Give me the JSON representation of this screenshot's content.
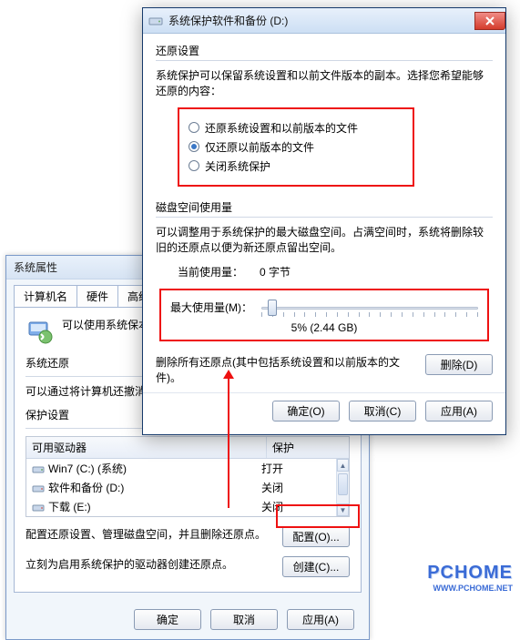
{
  "back": {
    "title": "系统属性",
    "tabs": [
      "计算机名",
      "硬件",
      "高级"
    ],
    "info": "可以使用系统保本的文件。什",
    "groups": {
      "restore_label": "系统还原",
      "restore_desc": "可以通过将计算机还撤消系统更改。",
      "protect_label": "保护设置"
    },
    "drives": {
      "head_drive": "可用驱动器",
      "head_protect": "保护",
      "rows": [
        {
          "name": "Win7 (C:) (系统)",
          "state": "打开"
        },
        {
          "name": "软件和备份 (D:)",
          "state": "关闭"
        },
        {
          "name": "下载 (E:)",
          "state": "关闭"
        }
      ]
    },
    "config_desc": "配置还原设置、管理磁盘空间，并且删除还原点。",
    "config_btn": "配置(O)...",
    "create_desc": "立刻为启用系统保护的驱动器创建还原点。",
    "create_btn": "创建(C)...",
    "ok": "确定",
    "cancel": "取消",
    "apply": "应用(A)"
  },
  "front": {
    "title": "系统保护软件和备份 (D:)",
    "restore": {
      "label": "还原设置",
      "desc": "系统保护可以保留系统设置和以前文件版本的副本。选择您希望能够还原的内容：",
      "opts": [
        "还原系统设置和以前版本的文件",
        "仅还原以前版本的文件",
        "关闭系统保护"
      ],
      "selected": 1
    },
    "disk": {
      "label": "磁盘空间使用量",
      "desc": "可以调整用于系统保护的最大磁盘空间。占满空间时，系统将删除较旧的还原点以便为新还原点留出空间。",
      "current_lbl": "当前使用量：",
      "current_val": "0 字节",
      "max_lbl": "最大使用量(M)：",
      "slider_val": "5% (2.44 GB)"
    },
    "del": {
      "desc": "删除所有还原点(其中包括系统设置和以前版本的文件)。",
      "btn": "删除(D)"
    },
    "ok": "确定(O)",
    "cancel": "取消(C)",
    "apply": "应用(A)"
  },
  "watermark": {
    "brand": "PCHOME",
    "url": "WWW.PCHOME.NET"
  }
}
